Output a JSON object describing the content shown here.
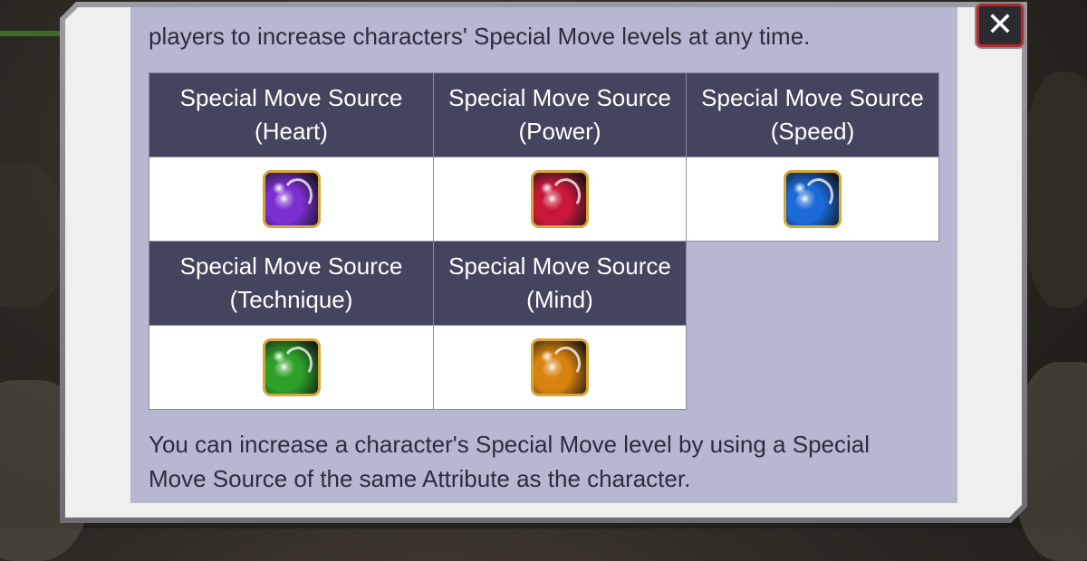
{
  "dialog": {
    "intro_text": "players to increase characters' Special Move levels at any time.",
    "footer_text": "You can increase a character's Special Move level by using a Special Move Source of the same Attribute as the character.",
    "close_icon": "close-icon"
  },
  "sources": [
    {
      "label_line1": "Special Move Source",
      "label_line2": "(Heart)",
      "icon": "heart-source-icon",
      "color": "#7a2fd0"
    },
    {
      "label_line1": "Special Move Source",
      "label_line2": "(Power)",
      "icon": "power-source-icon",
      "color": "#c8183a"
    },
    {
      "label_line1": "Special Move Source",
      "label_line2": "(Speed)",
      "icon": "speed-source-icon",
      "color": "#1a6ad8"
    },
    {
      "label_line1": "Special Move Source",
      "label_line2": "(Technique)",
      "icon": "technique-source-icon",
      "color": "#2ea02a"
    },
    {
      "label_line1": "Special Move Source",
      "label_line2": "(Mind)",
      "icon": "mind-source-icon",
      "color": "#d8820f"
    }
  ],
  "colors": {
    "header_bg": "#45445e",
    "content_bg": "#b7b7d2",
    "close_border": "#b3262b"
  }
}
